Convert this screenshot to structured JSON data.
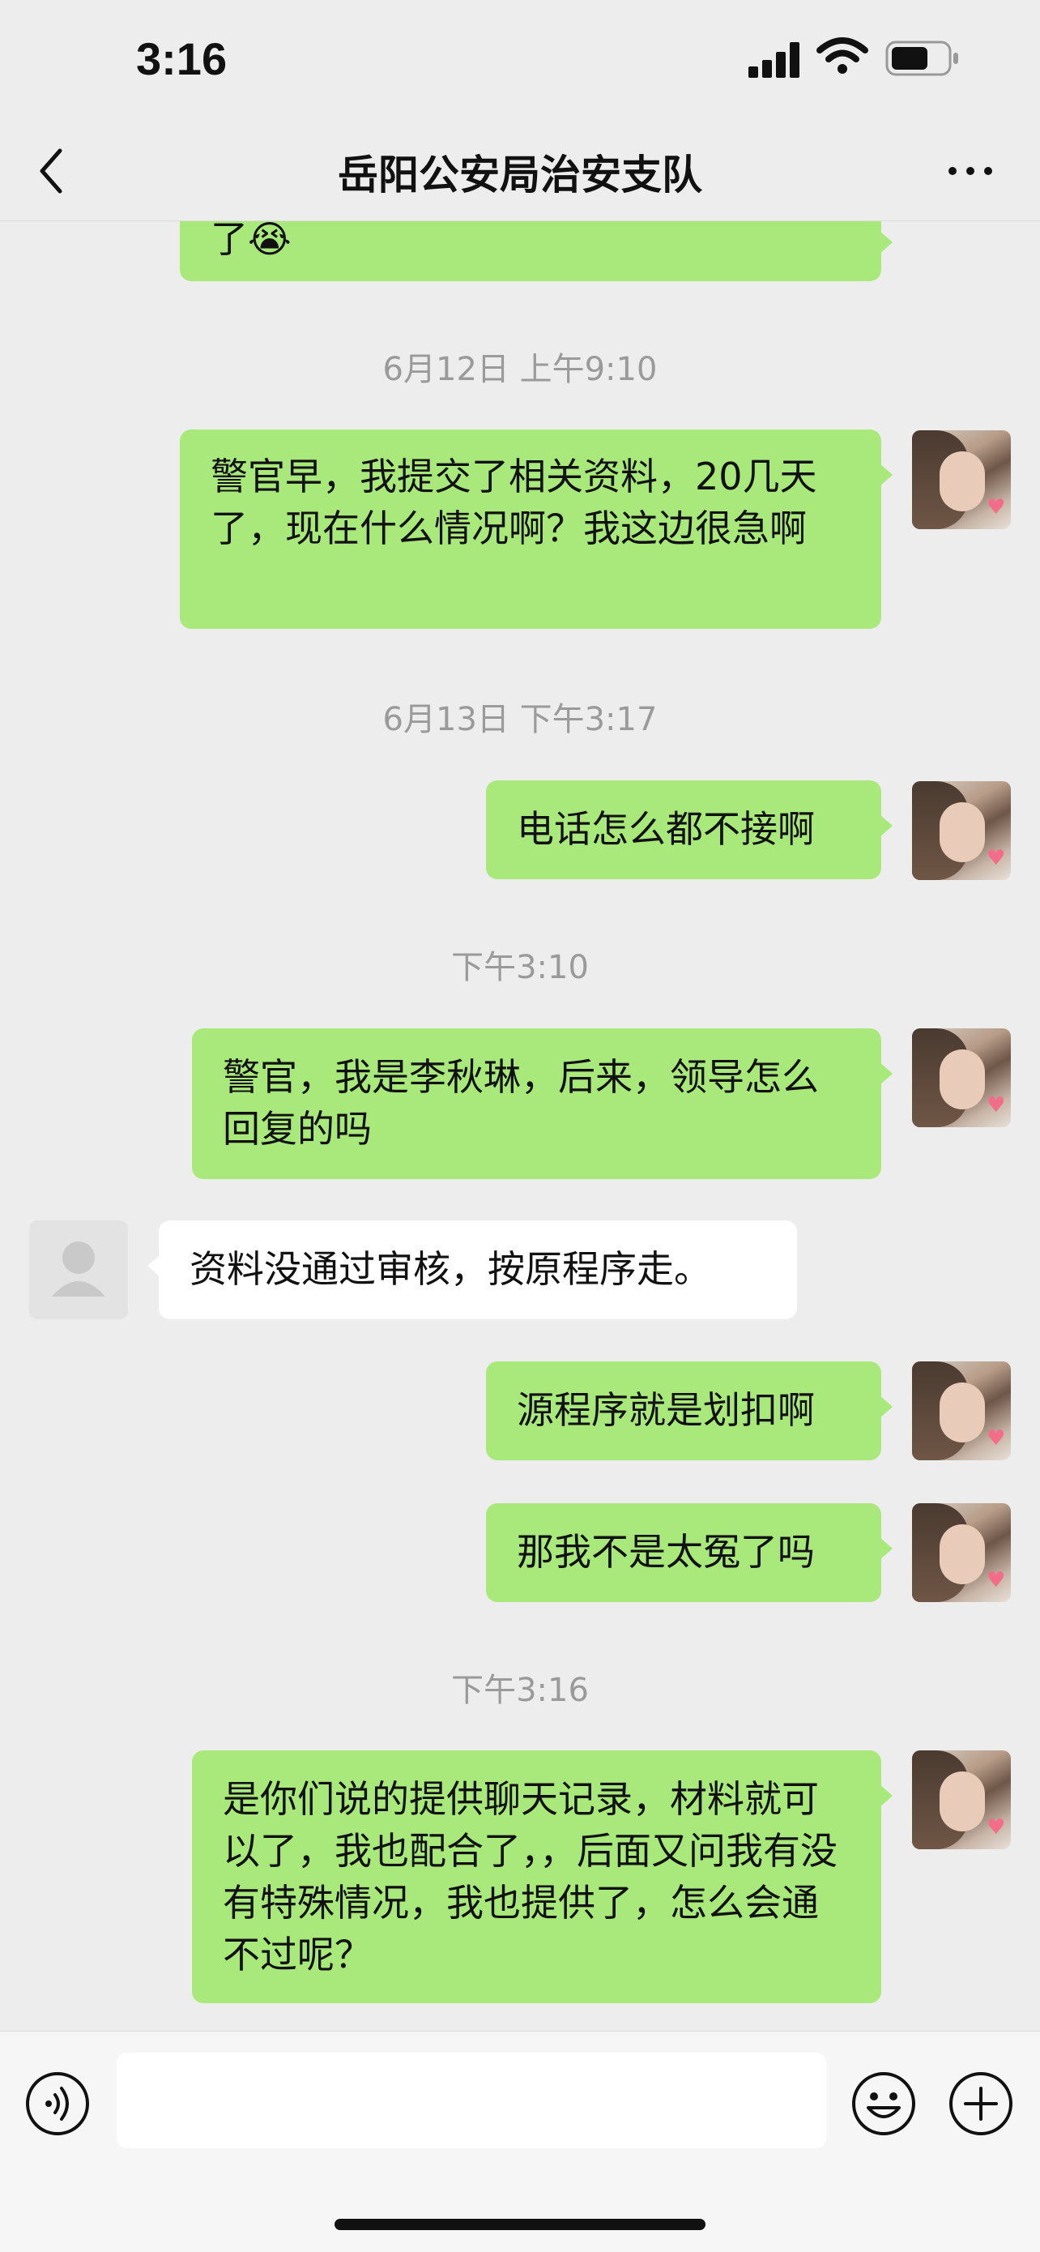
{
  "status_bar": {
    "time": "3:16"
  },
  "nav": {
    "title": "岳阳公安局治安支队"
  },
  "messages": [
    {
      "type": "out",
      "text": "了😭"
    },
    {
      "type": "time",
      "text": "6月12日 上午9:10"
    },
    {
      "type": "out",
      "text": "警官早，我提交了相关资料，20几天了，现在什么情况啊？我这边很急啊"
    },
    {
      "type": "time",
      "text": "6月13日 下午3:17"
    },
    {
      "type": "out",
      "text": "电话怎么都不接啊"
    },
    {
      "type": "time",
      "text": "下午3:10"
    },
    {
      "type": "out",
      "text": "警官，我是李秋琳，后来，领导怎么回复的吗"
    },
    {
      "type": "in",
      "text": "资料没通过审核，按原程序走。"
    },
    {
      "type": "out",
      "text": "源程序就是划扣啊"
    },
    {
      "type": "out",
      "text": "那我不是太冤了吗"
    },
    {
      "type": "time",
      "text": "下午3:16"
    },
    {
      "type": "out",
      "text": "是你们说的提供聊天记录，材料就可以了，我也配合了，，后面又问我有没有特殊情况，我也提供了，怎么会通不过呢？"
    }
  ],
  "input": {
    "value": ""
  },
  "icons": {
    "back": "chevron-left-icon",
    "more": "more-dots-icon",
    "voice": "voice-icon",
    "emoji": "emoji-icon",
    "plus": "plus-icon"
  },
  "colors": {
    "bubble_out": "#a9e87b",
    "bubble_in": "#ffffff",
    "background": "#ededed"
  }
}
